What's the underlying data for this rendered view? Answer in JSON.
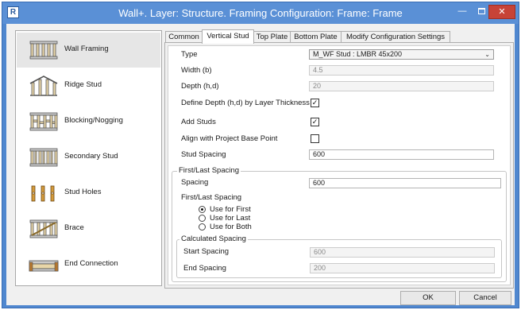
{
  "window": {
    "title": "Wall+. Layer: Structure. Framing Configuration: Frame: Frame",
    "app_icon_letter": "R",
    "close_glyph": "✕",
    "minimize_glyph": "—"
  },
  "nav": {
    "items": [
      {
        "label": "Wall Framing",
        "icon": "wall-framing-icon",
        "selected": true
      },
      {
        "label": "Ridge Stud",
        "icon": "ridge-stud-icon"
      },
      {
        "label": "Blocking/Nogging",
        "icon": "blocking-icon"
      },
      {
        "label": "Secondary Stud",
        "icon": "secondary-stud-icon"
      },
      {
        "label": "Stud Holes",
        "icon": "stud-holes-icon"
      },
      {
        "label": "Brace",
        "icon": "brace-icon"
      },
      {
        "label": "End Connection",
        "icon": "end-connection-icon"
      }
    ]
  },
  "tabs": [
    {
      "label": "Common"
    },
    {
      "label": "Vertical Stud",
      "active": true
    },
    {
      "label": "Top Plate"
    },
    {
      "label": "Bottom Plate"
    },
    {
      "label": "Modify Configuration Settings"
    }
  ],
  "form": {
    "type_label": "Type",
    "type_value": "M_WF Stud : LMBR 45x200",
    "width_label": "Width (b)",
    "width_value": "4.5",
    "depth_label": "Depth (h,d)",
    "depth_value": "20",
    "define_depth_label": "Define Depth (h,d) by Layer Thickness",
    "define_depth_checked": "✓",
    "add_studs_label": "Add Studs",
    "add_studs_checked": "✓",
    "align_label": "Align with Project Base Point",
    "stud_spacing_label": "Stud Spacing",
    "stud_spacing_value": "600"
  },
  "first_last": {
    "group_title": "First/Last Spacing",
    "spacing_label": "Spacing",
    "spacing_value": "600",
    "options_label": "First/Last Spacing",
    "options": [
      "Use for First",
      "Use for Last",
      "Use for Both"
    ],
    "selected_option": "Use for First"
  },
  "calculated": {
    "group_title": "Calculated Spacing",
    "start_label": "Start Spacing",
    "start_value": "600",
    "end_label": "End Spacing",
    "end_value": "200"
  },
  "buttons": {
    "ok": "OK",
    "cancel": "Cancel"
  },
  "colors": {
    "title_bar": "#5a90d6",
    "close_button": "#c74337",
    "nav_selected": "#e6e6e6"
  }
}
